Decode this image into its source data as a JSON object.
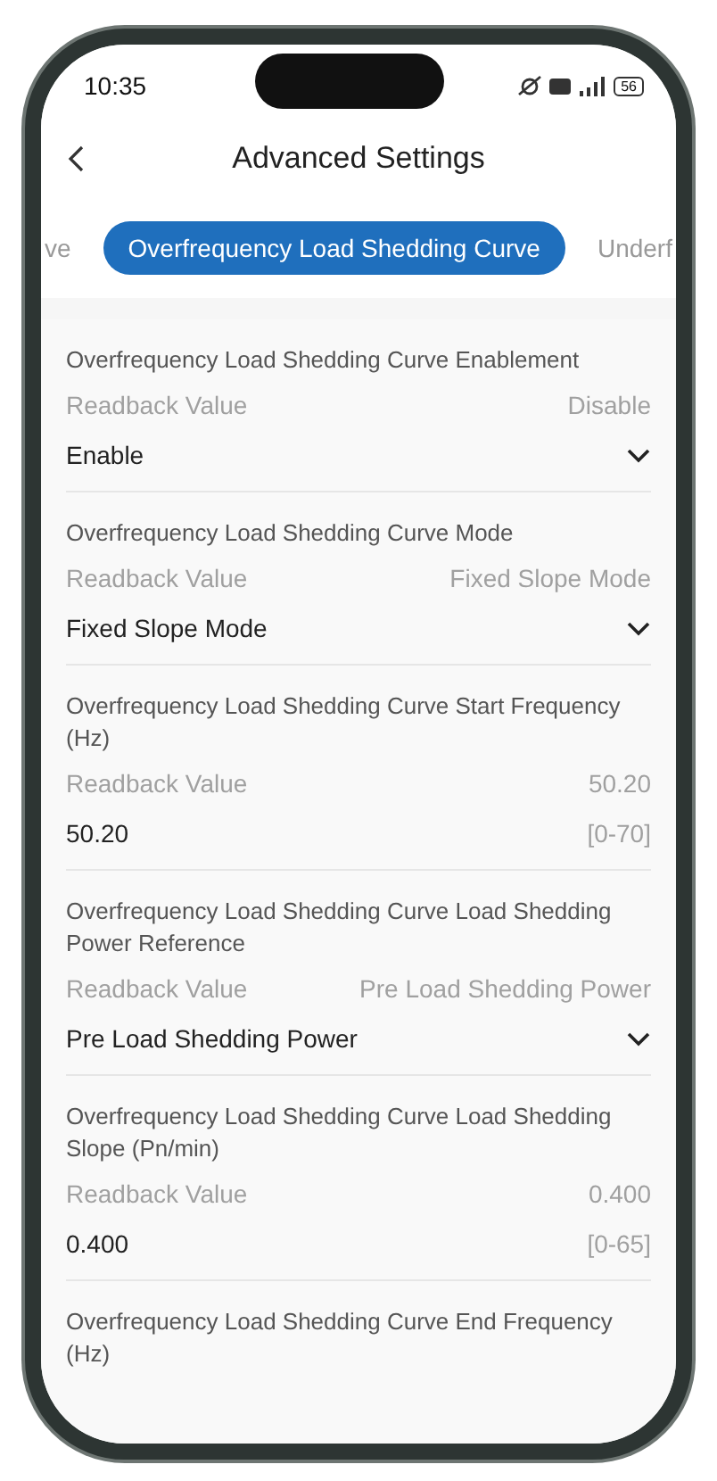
{
  "status_bar": {
    "time": "10:35",
    "battery": "56"
  },
  "header": {
    "title": "Advanced Settings"
  },
  "tabs": [
    {
      "label": "ve",
      "selected": false
    },
    {
      "label": "Overfrequency Load Shedding Curve",
      "selected": true
    },
    {
      "label": "Underf",
      "selected": false
    }
  ],
  "settings": [
    {
      "kind": "dropdown",
      "title": "Overfrequency Load Shedding Curve Enablement",
      "readback_label": "Readback Value",
      "readback_value": "Disable",
      "value": "Enable"
    },
    {
      "kind": "dropdown",
      "title": "Overfrequency Load Shedding Curve Mode",
      "readback_label": "Readback Value",
      "readback_value": "Fixed Slope Mode",
      "value": "Fixed Slope Mode"
    },
    {
      "kind": "input",
      "title": "Overfrequency Load Shedding Curve Start Frequency (Hz)",
      "readback_label": "Readback Value",
      "readback_value": "50.20",
      "value": "50.20",
      "range": "[0-70]"
    },
    {
      "kind": "dropdown",
      "title": "Overfrequency Load Shedding Curve Load Shedding Power Reference",
      "readback_label": "Readback Value",
      "readback_value": "Pre Load Shedding Power",
      "value": "Pre Load Shedding Power"
    },
    {
      "kind": "input",
      "title": "Overfrequency Load Shedding Curve Load Shedding Slope (Pn/min)",
      "readback_label": "Readback Value",
      "readback_value": "0.400",
      "value": "0.400",
      "range": "[0-65]"
    },
    {
      "kind": "partial",
      "title": "Overfrequency Load Shedding Curve End Frequency (Hz)"
    }
  ]
}
